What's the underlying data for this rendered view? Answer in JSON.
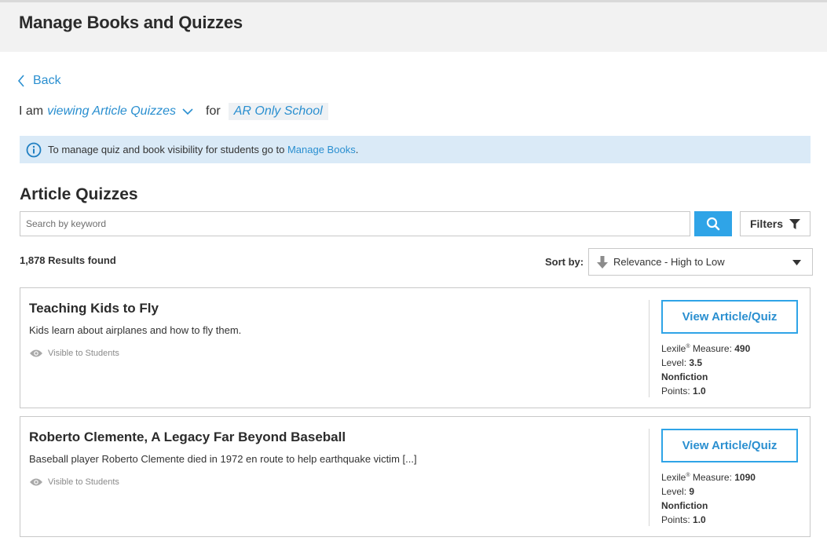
{
  "header": {
    "title": "Manage Books and Quizzes"
  },
  "nav": {
    "back_label": "Back"
  },
  "context": {
    "prefix": "I am",
    "mode": "viewing Article Quizzes",
    "for_label": "for",
    "school": "AR Only School"
  },
  "banner": {
    "text": "To manage quiz and book visibility for students go to",
    "link": "Manage Books",
    "suffix": "."
  },
  "section": {
    "title": "Article Quizzes"
  },
  "search": {
    "placeholder": "Search by keyword",
    "value": ""
  },
  "filters": {
    "label": "Filters"
  },
  "results": {
    "count_text": "1,878 Results found"
  },
  "sort": {
    "label": "Sort by:",
    "value": "Relevance - High to Low"
  },
  "articles": [
    {
      "title": "Teaching Kids to Fly",
      "description": "Kids learn about airplanes and how to fly them.",
      "visibility": "Visible to Students",
      "button": "View Article/Quiz",
      "lexile_label": "Lexile",
      "lexile_suffix": "Measure:",
      "lexile": "490",
      "level_label": "Level:",
      "level": "3.5",
      "genre": "Nonfiction",
      "points_label": "Points:",
      "points": "1.0"
    },
    {
      "title": "Roberto Clemente, A Legacy Far Beyond Baseball",
      "description": "Baseball player Roberto Clemente died in 1972 en route to help earthquake victim [...]",
      "visibility": "Visible to Students",
      "button": "View Article/Quiz",
      "lexile_label": "Lexile",
      "lexile_suffix": "Measure:",
      "lexile": "1090",
      "level_label": "Level:",
      "level": "9",
      "genre": "Nonfiction",
      "points_label": "Points:",
      "points": "1.0"
    }
  ],
  "colors": {
    "accent": "#2fa4e7",
    "link": "#2a8fd0",
    "banner_bg": "#daeaf7",
    "header_bg": "#f2f2f2"
  }
}
